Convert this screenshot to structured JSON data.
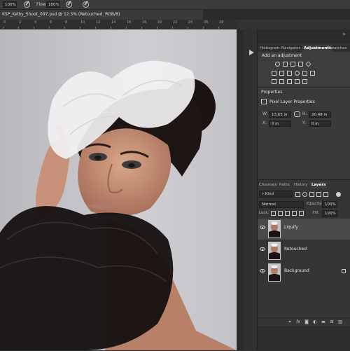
{
  "options_bar": {
    "size_value": "100%",
    "flow_label": "Flow:",
    "flow_value": "100%"
  },
  "document": {
    "tab_title": "KSP_Kelby_Shoot_097.psd @ 12.5% (Retouched, RGB/8)",
    "ruler_ticks": [
      "0",
      "2",
      "4",
      "6",
      "8",
      "10",
      "12",
      "14",
      "16",
      "18",
      "20",
      "22",
      "24",
      "26",
      "28"
    ]
  },
  "top_panel": {
    "tabs": [
      "Histogram",
      "Navigator",
      "Adjustments",
      "Swatches"
    ],
    "active_tab": "Adjustments",
    "adjustments_title": "Add an adjustment"
  },
  "properties": {
    "heading": "Properties",
    "title": "Pixel Layer Properties",
    "w_label": "W:",
    "w_value": "13.65 in",
    "h_label": "H:",
    "h_value": "20.48 in",
    "x_label": "X:",
    "x_value": "0 in",
    "y_label": "Y:",
    "y_value": "0 in"
  },
  "layers_panel": {
    "tabs": [
      "Channels",
      "Paths",
      "History",
      "Layers"
    ],
    "active_tab": "Layers",
    "kind_filter": "Kind",
    "blend_mode": "Normal",
    "opacity_label": "Opacity:",
    "opacity_value": "100%",
    "lock_label": "Lock:",
    "fill_label": "Fill:",
    "fill_value": "100%",
    "layers": [
      {
        "name": "Liquify",
        "selected": true,
        "locked": false
      },
      {
        "name": "Retouched",
        "selected": false,
        "locked": false
      },
      {
        "name": "Background",
        "selected": false,
        "locked": true
      }
    ],
    "footer_icons": [
      "link-icon",
      "fx-icon",
      "mask-icon",
      "adjustment-icon",
      "folder-icon",
      "new-layer-icon",
      "trash-icon"
    ]
  },
  "colors": {
    "selected_layer": "#4a4a4a",
    "panel_bg": "#353535",
    "canvas_bg": "#c9c8cc"
  }
}
